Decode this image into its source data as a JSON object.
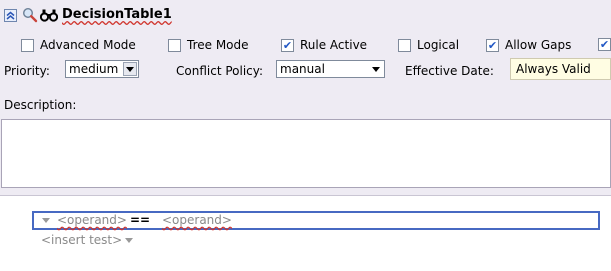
{
  "header": {
    "title": "DecisionTable1",
    "icons": [
      "collapse-icon",
      "search-icon",
      "binoculars-icon"
    ]
  },
  "options": [
    {
      "label": "Advanced Mode",
      "checked": false
    },
    {
      "label": "Tree Mode",
      "checked": false
    },
    {
      "label": "Rule Active",
      "checked": true
    },
    {
      "label": "Logical",
      "checked": false
    },
    {
      "label": "Allow Gaps",
      "checked": true
    },
    {
      "label": "",
      "checked": true
    }
  ],
  "priority": {
    "label": "Priority:",
    "value": "medium"
  },
  "conflict_policy": {
    "label": "Conflict Policy:",
    "value": "manual"
  },
  "effective_date": {
    "label": "Effective Date:",
    "value": "Always Valid"
  },
  "description": {
    "label": "Description:",
    "value": ""
  },
  "test": {
    "left_operand": "<operand>",
    "operator": "==",
    "right_operand": "<operand>",
    "insert_label": "<insert test>"
  },
  "colors": {
    "panel_bg": "#eeebf3",
    "accent_blue": "#4769c2",
    "effective_date_bg": "#fffde3",
    "error_underline": "#d0342c"
  }
}
